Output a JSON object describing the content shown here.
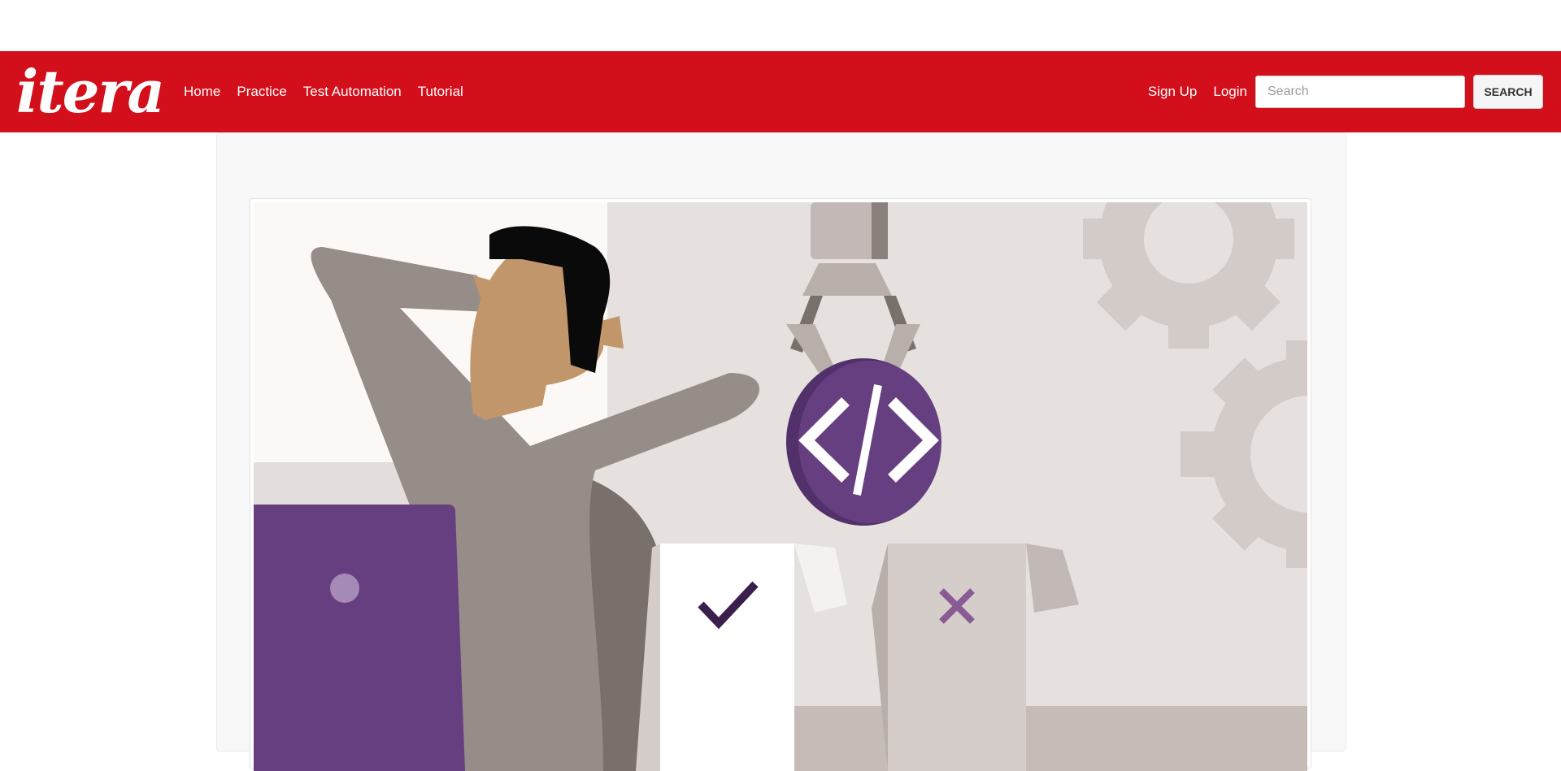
{
  "header": {
    "brand": "itera",
    "nav_left": [
      "Home",
      "Practice",
      "Test Automation",
      "Tutorial"
    ],
    "nav_right": [
      "Sign Up",
      "Login"
    ],
    "search": {
      "placeholder": "Search",
      "button_label": "SEARCH"
    }
  },
  "colors": {
    "brand_red": "#d20f1a",
    "purple": "#663f80",
    "gray": "#978d88"
  },
  "hero": {
    "icons": [
      "person-icon",
      "laptop-icon",
      "robot-claw-icon",
      "code-icon",
      "gear-icon",
      "checkmark-icon",
      "x-mark-icon"
    ]
  }
}
